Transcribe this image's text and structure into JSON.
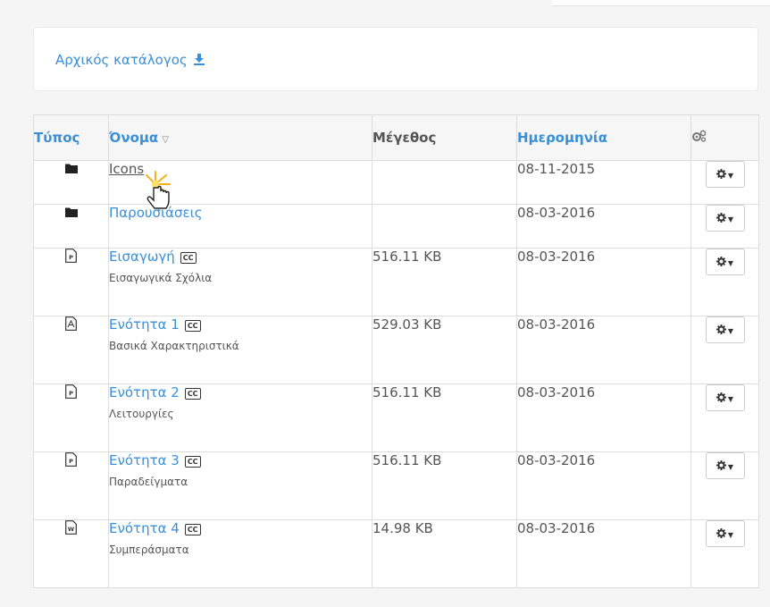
{
  "breadcrumb": {
    "root_label": "Αρχικός κατάλογος"
  },
  "table": {
    "headers": {
      "type": "Τύπος",
      "name": "Όνομα",
      "size": "Μέγεθος",
      "date": "Ημερομηνία"
    },
    "rows": [
      {
        "type": "folder",
        "icon": "folder-icon",
        "name": "Icons",
        "subtitle": "",
        "size": "",
        "date": "08-11-2015",
        "cc": false
      },
      {
        "type": "folder",
        "icon": "folder-icon",
        "name": "Παρουσιάσεις",
        "subtitle": "",
        "size": "",
        "date": "08-03-2016",
        "cc": false
      },
      {
        "type": "file",
        "icon": "ppt-file-icon",
        "name": "Εισαγωγή",
        "subtitle": "Εισαγωγικά Σχόλια",
        "size": "516.11 KB",
        "date": "08-03-2016",
        "cc": true
      },
      {
        "type": "file",
        "icon": "pdf-file-icon",
        "name": "Ενότητα 1",
        "subtitle": "Βασικά Χαρακτηριστικά",
        "size": "529.03 KB",
        "date": "08-03-2016",
        "cc": true
      },
      {
        "type": "file",
        "icon": "ppt-file-icon",
        "name": "Ενότητα 2",
        "subtitle": "Λειτουργίες",
        "size": "516.11 KB",
        "date": "08-03-2016",
        "cc": true
      },
      {
        "type": "file",
        "icon": "ppt-file-icon",
        "name": "Ενότητα 3",
        "subtitle": "Παραδείγματα",
        "size": "516.11 KB",
        "date": "08-03-2016",
        "cc": true
      },
      {
        "type": "file",
        "icon": "word-file-icon",
        "name": "Ενότητα 4",
        "subtitle": "Συμπεράσματα",
        "size": "14.98 KB",
        "date": "08-03-2016",
        "cc": true
      }
    ]
  },
  "badges": {
    "cc_label": "CC"
  },
  "colors": {
    "link": "#3a8fd6",
    "header_bg": "#f6f6f6",
    "border": "#dddddd"
  }
}
